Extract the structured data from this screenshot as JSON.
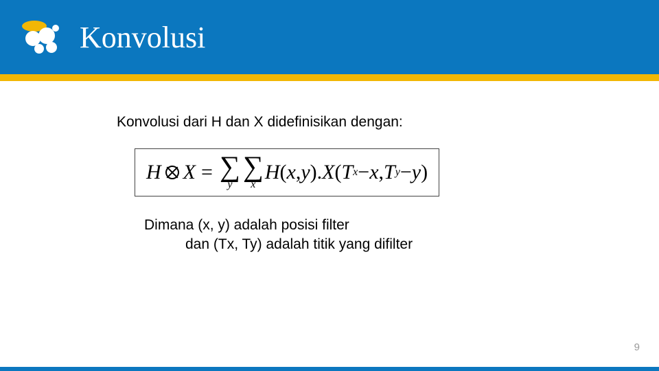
{
  "header": {
    "title": "Konvolusi",
    "logo_name": "brand-logo"
  },
  "content": {
    "intro": "Konvolusi dari H dan X didefinisikan dengan:",
    "formula": {
      "lhs_h": "H",
      "lhs_x": "X",
      "eq": "=",
      "sum1_sub": "y",
      "sum2_sub": "x",
      "rhs_h": "H",
      "xy_open": "(",
      "xy_x": "x",
      "xy_comma": ", ",
      "xy_y": "y",
      "xy_close": ").",
      "rhs_x": "X",
      "tx_open": "(",
      "tx_t1": "T",
      "tx_sub1": "x",
      "tx_minus1": " − ",
      "tx_x": "x",
      "tx_comma": ", ",
      "tx_t2": "T",
      "tx_sub2": "y",
      "tx_minus2": " − ",
      "tx_y": "y",
      "tx_close": ")"
    },
    "explain_line1": "Dimana (x, y) adalah posisi filter",
    "explain_line2": "dan (Tx, Ty) adalah titik yang difilter"
  },
  "page_number": "9",
  "colors": {
    "header_bg": "#0b77bf",
    "accent": "#f2b705"
  }
}
